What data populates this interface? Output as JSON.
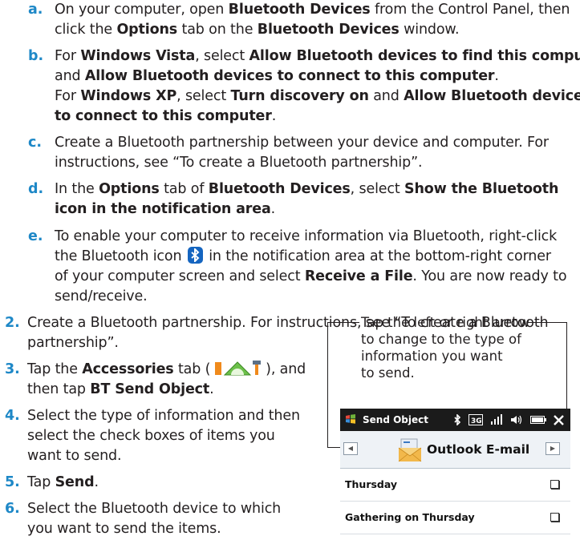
{
  "substeps": [
    {
      "label": "a.",
      "lines": [
        [
          {
            "t": "On your computer, open "
          },
          {
            "t": "Bluetooth Devices",
            "b": 1
          },
          {
            "t": " from the Control Panel, then"
          }
        ],
        [
          {
            "t": "click the "
          },
          {
            "t": "Options",
            "b": 1
          },
          {
            "t": " tab on the "
          },
          {
            "t": "Bluetooth Devices",
            "b": 1
          },
          {
            "t": " window."
          }
        ]
      ]
    },
    {
      "label": "b.",
      "lines": [
        [
          {
            "t": "For "
          },
          {
            "t": "Windows Vista",
            "b": 1
          },
          {
            "t": ", select "
          },
          {
            "t": "Allow Bluetooth devices to find this computer",
            "b": 1
          }
        ],
        [
          {
            "t": "and "
          },
          {
            "t": "Allow Bluetooth devices to connect to this computer",
            "b": 1
          },
          {
            "t": "."
          }
        ],
        [
          {
            "t": "For "
          },
          {
            "t": "Windows XP",
            "b": 1
          },
          {
            "t": ", select "
          },
          {
            "t": "Turn discovery on",
            "b": 1
          },
          {
            "t": " and "
          },
          {
            "t": "Allow Bluetooth devices",
            "b": 1
          }
        ],
        [
          {
            "t": "to connect to this computer",
            "b": 1
          },
          {
            "t": "."
          }
        ]
      ]
    },
    {
      "label": "c.",
      "lines": [
        [
          {
            "t": "Create a Bluetooth partnership between your device and computer. For"
          }
        ],
        [
          {
            "t": "instructions, see “To create a Bluetooth partnership”."
          }
        ]
      ]
    },
    {
      "label": "d.",
      "lines": [
        [
          {
            "t": "In the "
          },
          {
            "t": "Options",
            "b": 1
          },
          {
            "t": " tab of "
          },
          {
            "t": "Bluetooth Devices",
            "b": 1
          },
          {
            "t": ", select "
          },
          {
            "t": "Show the Bluetooth",
            "b": 1
          }
        ],
        [
          {
            "t": "icon in the notification area",
            "b": 1
          },
          {
            "t": "."
          }
        ]
      ]
    },
    {
      "label": "e.",
      "lines": [
        [
          {
            "t": "To enable your computer to receive information via Bluetooth, right-click"
          }
        ],
        [
          {
            "t": "the Bluetooth icon "
          },
          {
            "icon": "bluetooth-icon"
          },
          {
            "t": " in the notification area at the bottom-right corner"
          }
        ],
        [
          {
            "t": "of your computer screen and select "
          },
          {
            "t": "Receive a File",
            "b": 1
          },
          {
            "t": ". You are now ready to"
          }
        ],
        [
          {
            "t": "send/receive."
          }
        ]
      ]
    }
  ],
  "steps": [
    {
      "label": "2.",
      "lines": [
        [
          {
            "t": "Create a Bluetooth partnership. For instructions, see “To create a Bluetooth"
          }
        ],
        [
          {
            "t": "partnership”."
          }
        ]
      ]
    },
    {
      "label": "3.",
      "lines": [
        [
          {
            "t": "Tap the "
          },
          {
            "t": "Accessories",
            "b": 1
          },
          {
            "t": " tab ( "
          },
          {
            "icon": "accessories-icon"
          },
          {
            "t": " ), and"
          }
        ],
        [
          {
            "t": "then tap "
          },
          {
            "t": "BT Send Object",
            "b": 1
          },
          {
            "t": "."
          }
        ]
      ]
    },
    {
      "label": "4.",
      "lines": [
        [
          {
            "t": "Select the type of information and then"
          }
        ],
        [
          {
            "t": "select the check boxes of items you"
          }
        ],
        [
          {
            "t": "want to send."
          }
        ]
      ]
    },
    {
      "label": "5.",
      "lines": [
        [
          {
            "t": "Tap "
          },
          {
            "t": "Send",
            "b": 1
          },
          {
            "t": "."
          }
        ]
      ]
    },
    {
      "label": "6.",
      "lines": [
        [
          {
            "t": "Select the Bluetooth device to which"
          }
        ],
        [
          {
            "t": "you want to send the items."
          }
        ]
      ]
    }
  ],
  "callout": {
    "lines": [
      "Tap the left or right arrow",
      "to change to the type of",
      "information you want",
      "to send."
    ]
  },
  "phone": {
    "title": "Send Object",
    "status_icons": [
      "bluetooth-icon",
      "signal-3g-icon",
      "signal-strength-icon",
      "volume-icon",
      "battery-icon",
      "close-icon"
    ],
    "selector_label": "Outlook E-mail",
    "rows": [
      "Thursday",
      "Gathering on Thursday"
    ]
  },
  "colors": {
    "accent": "#1e88c7",
    "text": "#231f20"
  }
}
